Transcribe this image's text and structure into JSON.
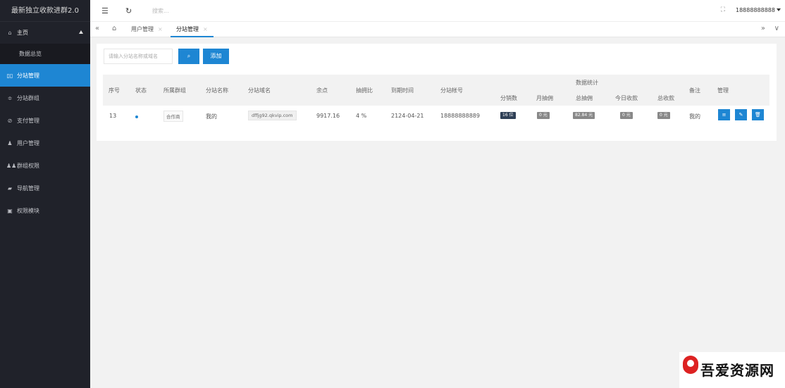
{
  "app": {
    "title": "最新独立收款进群2.0"
  },
  "header": {
    "search_placeholder": "搜索...",
    "user": "18888888888"
  },
  "sidebar": {
    "items": [
      {
        "label": "主页",
        "icon": "home-icon"
      },
      {
        "label": "数据总览",
        "icon": ""
      },
      {
        "label": "分站管理",
        "icon": "grid-icon"
      },
      {
        "label": "分站群组",
        "icon": "sliders-icon"
      },
      {
        "label": "支付管理",
        "icon": "check-circle-icon"
      },
      {
        "label": "用户管理",
        "icon": "user-icon"
      },
      {
        "label": "群组权限",
        "icon": "users-icon"
      },
      {
        "label": "导航管理",
        "icon": "nav-icon"
      },
      {
        "label": "权限模块",
        "icon": "module-icon"
      }
    ]
  },
  "tabs": [
    {
      "label": "用户管理",
      "close": "×"
    },
    {
      "label": "分站管理",
      "close": "×"
    }
  ],
  "toolbar": {
    "search_placeholder": "请输入分站名称或域名",
    "add_label": "添加"
  },
  "table": {
    "group_header": "数据统计",
    "columns": {
      "id": "序号",
      "status": "状态",
      "group": "所属群组",
      "name": "分站名称",
      "domain": "分站域名",
      "balance": "余点",
      "ratio": "抽拥比",
      "expire": "到期时间",
      "account": "分站帐号",
      "sub_count": "分销数",
      "month_comm": "月抽佣",
      "total_comm": "总抽佣",
      "today_income": "今日收款",
      "total_income": "总收款",
      "remark": "备注",
      "manage": "管理"
    },
    "rows": [
      {
        "id": "13",
        "group": "合作商",
        "name": "我的",
        "domain": "dffjg92.qkvip.com",
        "balance": "9917.16",
        "ratio": "4 %",
        "expire": "2124-04-21",
        "account": "18888888889",
        "sub_count": "16 位",
        "month_comm": "0 元",
        "total_comm": "82.84 元",
        "today_income": "0 元",
        "total_income": "0 元",
        "remark": "我的"
      }
    ]
  },
  "watermark": {
    "text": "吾爱资源网"
  },
  "colors": {
    "primary": "#1e86d3",
    "sidebar": "#20222a",
    "dark_badge": "#2f4056"
  }
}
